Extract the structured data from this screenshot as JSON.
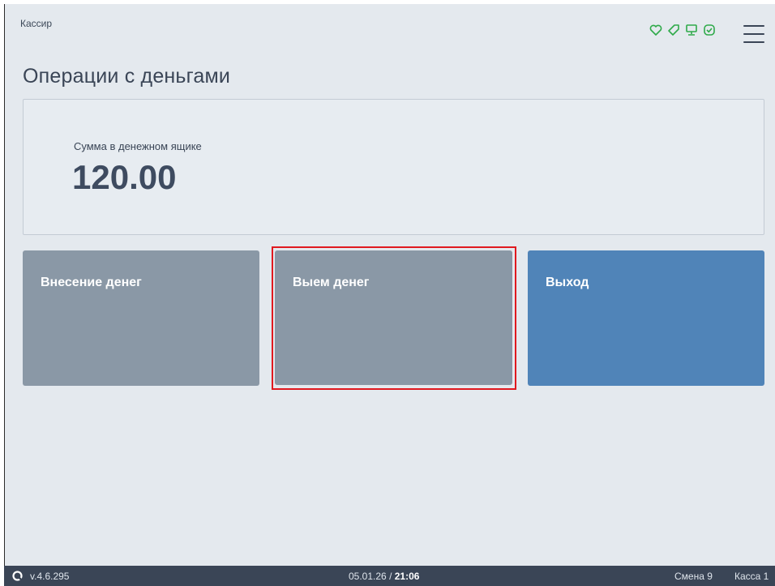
{
  "header": {
    "role": "Кассир",
    "page_title": "Операции с деньгами"
  },
  "status_icons": [
    {
      "name": "heart-icon",
      "color": "#2faa4a"
    },
    {
      "name": "tag-icon",
      "color": "#2faa4a"
    },
    {
      "name": "monitor-icon",
      "color": "#2faa4a"
    },
    {
      "name": "fiscal-check-icon",
      "color": "#2faa4a"
    }
  ],
  "drawer": {
    "label": "Сумма в денежном ящике",
    "amount": "120.00"
  },
  "actions": {
    "deposit_label": "Внесение денег",
    "withdraw_label": "Выем денег",
    "exit_label": "Выход"
  },
  "colors": {
    "neutral_button": "#8a98a6",
    "primary_button": "#5084b8",
    "background": "#e4e9ee",
    "footer": "#3a4556",
    "highlight": "#e0191f"
  },
  "footer": {
    "version": "v.4.6.295",
    "date": "05.01.26",
    "separator": "/",
    "time": "21:06",
    "shift": "Смена 9",
    "register": "Касса 1"
  }
}
